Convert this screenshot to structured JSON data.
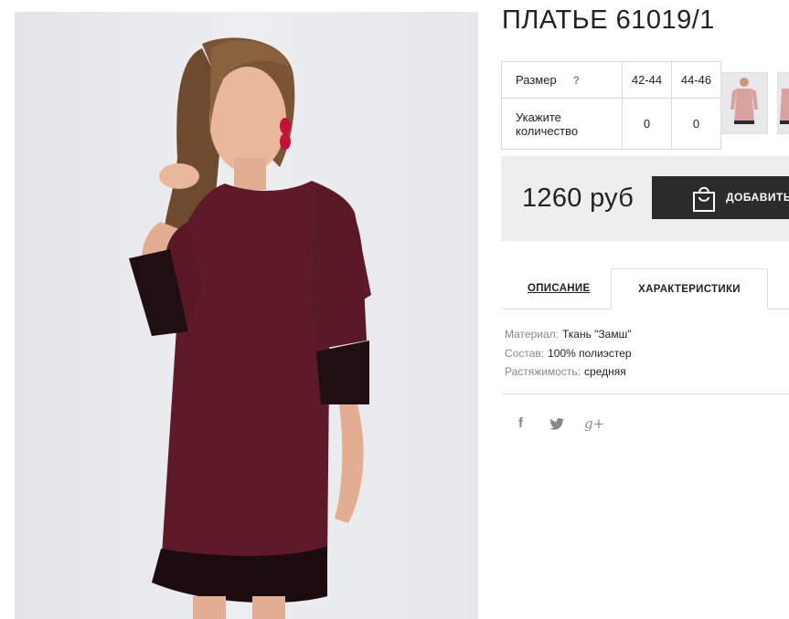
{
  "product": {
    "title": "ПЛАТЬЕ 61019/1",
    "photo_alt": "dress-photo"
  },
  "size_table": {
    "size_label": "Размер",
    "help_mark": "?",
    "sizes": [
      "42-44",
      "44-46"
    ],
    "qty_label": "Укажите количество",
    "quantities": [
      "0",
      "0"
    ]
  },
  "purchase": {
    "price": "1260 руб",
    "add_button_label": "ДОБАВИТЬ"
  },
  "tabs": [
    {
      "label": "ОПИСАНИЕ"
    },
    {
      "label": "ХАРАКТЕРИСТИКИ"
    }
  ],
  "specs": [
    {
      "key": "Материал:",
      "value": "Ткань \"Замш\""
    },
    {
      "key": "Состав:",
      "value": "100% полиэстер"
    },
    {
      "key": "Растяжимость:",
      "value": "средняя"
    }
  ],
  "social": {
    "facebook": "f",
    "twitter": "twitter-icon",
    "google": "g+"
  },
  "colors": {
    "dress": "#5e1a28",
    "button": "#2b2b2b",
    "price_bg": "#eeeeee"
  }
}
